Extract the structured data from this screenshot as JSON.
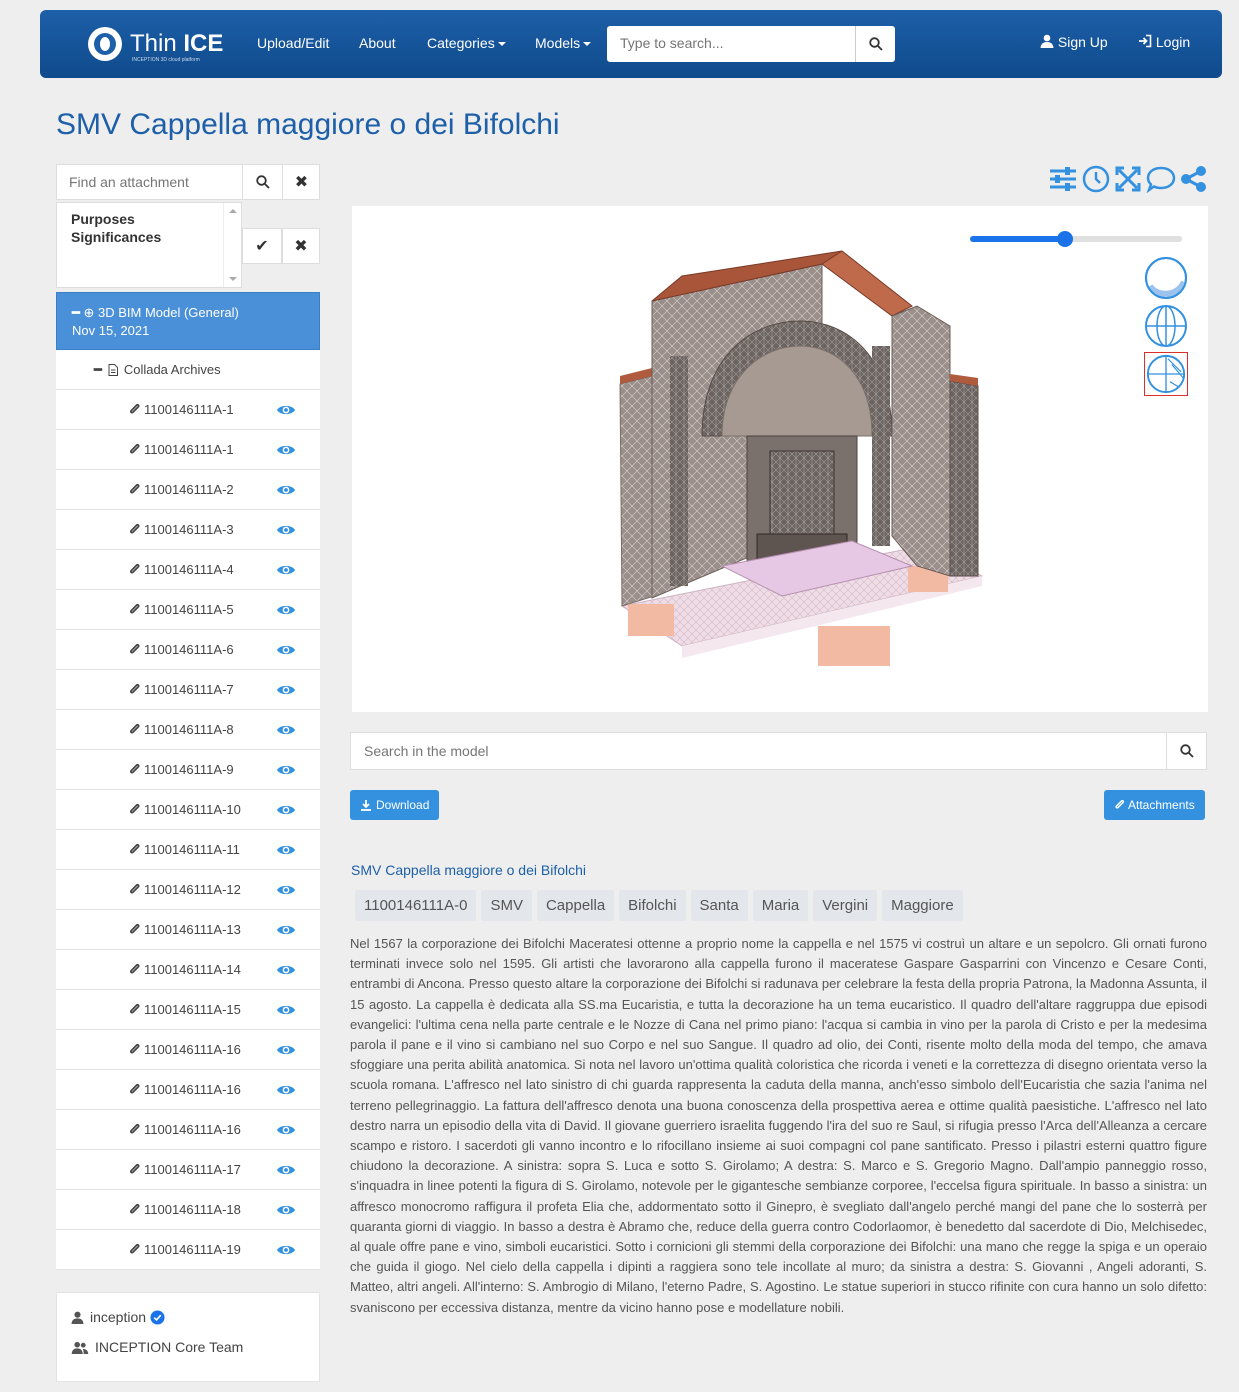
{
  "navbar": {
    "brand_thin": "Thin",
    "brand_ice": "ICE",
    "brand_sub": "INCEPTION 3D cloud platform",
    "links": [
      "Upload/Edit",
      "About",
      "Categories",
      "Models"
    ],
    "search_placeholder": "Type to search...",
    "signup": "Sign Up",
    "login": "Login"
  },
  "page_title": "SMV Cappella maggiore o dei Bifolchi",
  "sidebar": {
    "find_placeholder": "Find an attachment",
    "purposes": [
      "Purposes",
      "Significances"
    ],
    "root_label": "3D BIM Model (General)",
    "root_date": "Nov 15, 2021",
    "folder_label": "Collada Archives",
    "files": [
      "1100146111A-1",
      "1100146111A-1",
      "1100146111A-2",
      "1100146111A-3",
      "1100146111A-4",
      "1100146111A-5",
      "1100146111A-6",
      "1100146111A-7",
      "1100146111A-8",
      "1100146111A-9",
      "1100146111A-10",
      "1100146111A-11",
      "1100146111A-12",
      "1100146111A-13",
      "1100146111A-14",
      "1100146111A-15",
      "1100146111A-16",
      "1100146111A-16",
      "1100146111A-16",
      "1100146111A-17",
      "1100146111A-18",
      "1100146111A-19"
    ],
    "owner": "inception",
    "team": "INCEPTION Core Team"
  },
  "viewer": {
    "slider_value": 0.45
  },
  "main": {
    "model_search_placeholder": "Search in the model",
    "download_label": "Download",
    "attachments_label": "Attachments",
    "subtitle": "SMV Cappella maggiore o dei Bifolchi",
    "tags": [
      "1100146111A-0",
      "SMV",
      "Cappella",
      "Bifolchi",
      "Santa",
      "Maria",
      "Vergini",
      "Maggiore"
    ],
    "description": "Nel 1567 la corporazione dei Bifolchi Maceratesi ottenne a proprio nome la cappella e nel 1575 vi costruì un altare e un sepolcro. Gli ornati furono terminati invece solo nel 1595. Gli artisti che lavorarono alla cappella furono il maceratese Gaspare Gasparrini con Vincenzo e Cesare Conti, entrambi di Ancona. Presso questo altare la corporazione dei Bifolchi si radunava per celebrare la festa della propria Patrona, la Madonna Assunta, il 15 agosto. La cappella è dedicata alla SS.ma Eucaristia, e tutta la decorazione ha un tema eucaristico. Il quadro dell'altare raggruppa due episodi evangelici: l'ultima cena nella parte centrale e le Nozze di Cana nel primo piano: l'acqua si cambia in vino per la parola di Cristo e per la medesima parola il pane e il vino si cambiano nel suo Corpo e nel suo Sangue. Il quadro ad olio, dei Conti, risente molto della moda del tempo, che amava sfoggiare una perita abilità anatomica. Si nota nel lavoro un'ottima qualità coloristica che ricorda i veneti e la correttezza di disegno orientata verso la scuola romana. L'affresco nel lato sinistro di chi guarda rappresenta la caduta della manna, anch'esso simbolo dell'Eucaristia che sazia l'anima nel terreno pellegrinaggio. La fattura dell'affresco denota una buona conoscenza della prospettiva aerea e ottime qualità paesistiche. L'affresco nel lato destro narra un episodio della vita di David. Il giovane guerriero israelita fuggendo l'ira del suo re Saul, si rifugia presso l'Arca dell'Alleanza a cercare scampo e ristoro. I sacerdoti gli vanno incontro e lo rifocillano insieme ai suoi compagni col pane santificato. Presso i pilastri esterni quattro figure chiudono la decorazione. A sinistra: sopra S. Luca e sotto S. Girolamo; A destra: S. Marco e S. Gregorio Magno. Dall'ampio panneggio rosso, s'inquadra in linee potenti la figura di S. Girolamo, notevole per le gigantesche sembianze corporee, l'eccelsa figura spirituale. In basso a sinistra: un affresco monocromo raffigura il profeta Elia che, addormentato sotto il Ginepro, è svegliato dall'angelo perché mangi del pane che lo sosterrà per quaranta giorni di viaggio. In basso a destra è Abramo che, reduce della guerra contro Codorlaomor, è benedetto dal sacerdote di Dio, Melchisedec, al quale offre pane e vino, simboli eucaristici. Sotto i cornicioni gli stemmi della corporazione dei Bifolchi: una mano che regge la spiga e un operaio che guida il giogo. Nel cielo della cappella i dipinti a raggiera sono tele incollate al muro; da sinistra a destra: S. Giovanni , Angeli adoranti, S. Matteo, altri angeli. All'interno: S. Ambrogio di Milano, l'eterno Padre, S. Agostino. Le statue superiori in stucco rifinite con cura hanno un solo difetto: svaniscono per eccessiva distanza, mentre da vicino hanno pose e modellature nobili."
  },
  "colors": {
    "navbar": "#1d5fa8",
    "accent": "#3391e0",
    "tree_active": "#4a90d9"
  }
}
